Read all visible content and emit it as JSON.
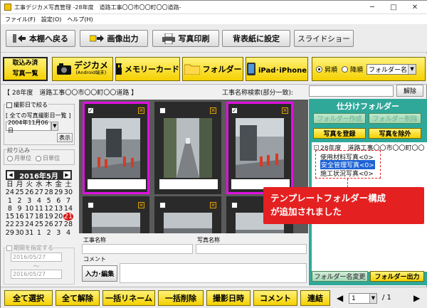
{
  "window": {
    "title": "工事デジカメ写真管理 -28年度　道路工事〇〇市〇〇町〇〇道路-",
    "minimize": "─",
    "maximize": "□",
    "close": "✕"
  },
  "menu": [
    "ファイル(F)",
    "設定(O)",
    "ヘルプ(H)"
  ],
  "toolbar": {
    "back": "本棚へ戻る",
    "image_output": "画像出力",
    "photo_print": "写真印刷",
    "wallpaper": "背表紙に設定",
    "slideshow": "スライドショー"
  },
  "sources": {
    "imported_line1": "取込み済",
    "imported_line2": "写真一覧",
    "digicam": "デジカメ",
    "digicam_sub": "(Android端末)",
    "memory_card": "メモリーカード",
    "folder": "フォルダー",
    "ipad": "iPad･iPhone"
  },
  "sort": {
    "asc": "昇順",
    "desc": "降順",
    "selected": "フォルダー名"
  },
  "path": "【 28年度　道路工事〇〇市〇〇町〇〇道路 】",
  "search": {
    "label": "工事名称検索(部分一致):",
    "value": "",
    "clear": "解除"
  },
  "filter": {
    "by_date_label": "撮影日で絞る",
    "all_dates": "[ 全ての写真撮影日一覧 ]",
    "date_value": "2004年11月06日",
    "show": "表示",
    "narrow_label": "絞り込み",
    "monthly": "月単位",
    "daily": "日単位"
  },
  "calendar": {
    "month": "2016年5月",
    "prev": "◀",
    "next": "▶",
    "weekdays": [
      "日",
      "月",
      "火",
      "水",
      "木",
      "金",
      "土"
    ],
    "days": [
      "24",
      "25",
      "26",
      "27",
      "28",
      "29",
      "30",
      "1",
      "2",
      "3",
      "4",
      "5",
      "6",
      "7",
      "8",
      "9",
      "10",
      "11",
      "12",
      "13",
      "14",
      "15",
      "16",
      "17",
      "18",
      "19",
      "20",
      "21",
      "22",
      "23",
      "24",
      "25",
      "26",
      "27",
      "28",
      "29",
      "30",
      "31",
      "1",
      "2",
      "3",
      "4"
    ],
    "highlighted": "21",
    "period_label": "期間を指定する",
    "period_from": "2016/05/27",
    "period_sep": "～",
    "period_to": "2016/05/27"
  },
  "photo_info": {
    "project_label": "工事名称",
    "photo_name_label": "写真名称",
    "comment_label": "コメント",
    "edit_button": "入力･編集"
  },
  "sort_panel": {
    "title": "仕分けフォルダー",
    "create_folder": "フォルダー作成",
    "delete_folder": "フォルダー削除",
    "register_photo": "写真を登録",
    "remove_photo": "写真を除外",
    "tree_root": "28年度　道路工事〇〇市〇〇町〇〇",
    "tree_items": [
      "使用材料写真<0>",
      "安全管理写真<0>",
      "施工状況写真<0>"
    ],
    "rename_folder": "フォルダー名変更",
    "folder_output": "フォルダー出力"
  },
  "callout": {
    "line1": "テンプレートフォルダー構成",
    "line2": "が追加されました"
  },
  "bottom": {
    "select_all": "全て選択",
    "deselect_all": "全て解除",
    "batch_rename": "一括リネーム",
    "batch_delete": "一括削除",
    "shoot_date": "撮影日時",
    "comment": "コメント",
    "link": "連結",
    "page_value": "1",
    "page_total": "/ 1"
  }
}
